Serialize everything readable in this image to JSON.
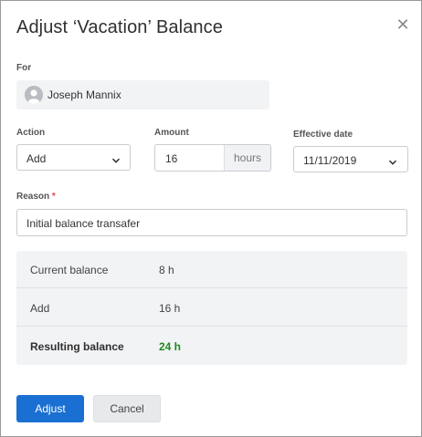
{
  "dialog": {
    "title": "Adjust ‘Vacation’ Balance"
  },
  "for_field": {
    "label": "For",
    "name": "Joseph Mannix"
  },
  "action_field": {
    "label": "Action",
    "value": "Add"
  },
  "amount_field": {
    "label": "Amount",
    "value": "16",
    "unit": "hours"
  },
  "effective_date_field": {
    "label": "Effective date",
    "value": "11/11/2019"
  },
  "reason_field": {
    "label": "Reason",
    "required_marker": "*",
    "value": "Initial balance transafer"
  },
  "summary": {
    "rows": [
      {
        "label": "Current balance",
        "value": "8 h"
      },
      {
        "label": "Add",
        "value": "16 h"
      },
      {
        "label": "Resulting balance",
        "value": "24 h"
      }
    ],
    "result_color": "#1f8a1f"
  },
  "buttons": {
    "primary_label": "Adjust",
    "secondary_label": "Cancel",
    "primary_color": "#1a6fd2"
  },
  "icons": {
    "close": "close-icon",
    "avatar": "user-avatar-icon",
    "chevron": "chevron-down-icon"
  }
}
